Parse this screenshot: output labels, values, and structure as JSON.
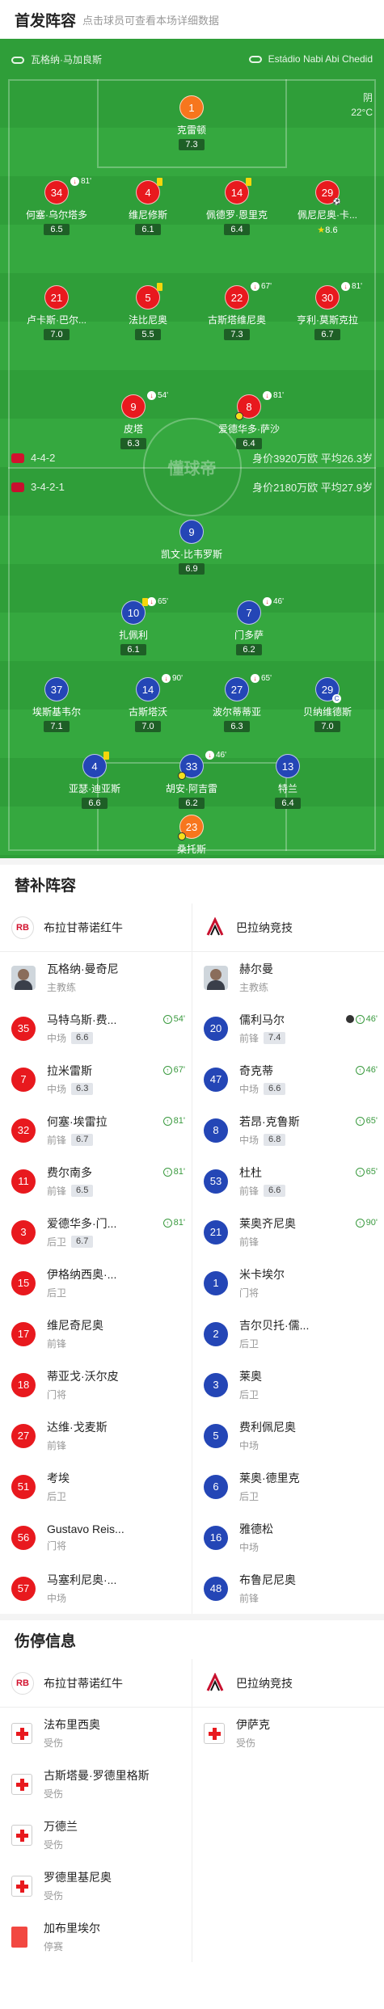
{
  "header": {
    "title": "首发阵容",
    "subtitle": "点击球员可查看本场详细数据"
  },
  "pitch": {
    "venue_left": "瓦格纳·马加良斯",
    "venue_right": "Estádio Nabi Abi Chedid",
    "weather": "阴",
    "temperature": "22°C",
    "center_logo": "懂球帝",
    "home_formation": "4-4-2",
    "home_value": "身价3920万欧 平均26.3岁",
    "away_formation": "3-4-2-1",
    "away_value": "身价2180万欧 平均27.9岁"
  },
  "home_players": [
    {
      "num": "1",
      "name": "克雷顿",
      "rating": "7.3",
      "color": "gk"
    },
    {
      "num": "34",
      "name": "何塞·乌尔塔多",
      "rating": "6.5",
      "sub": "81'"
    },
    {
      "num": "4",
      "name": "维尼修斯",
      "rating": "6.1",
      "yc": true
    },
    {
      "num": "14",
      "name": "佩德罗·恩里克",
      "rating": "6.4",
      "yc": true
    },
    {
      "num": "29",
      "name": "佩尼尼奥·卡...",
      "rating": "8.6",
      "star": true,
      "goal": true
    },
    {
      "num": "21",
      "name": "卢卡斯·巴尔...",
      "rating": "7.0"
    },
    {
      "num": "5",
      "name": "法比尼奥",
      "rating": "5.5",
      "yc": true
    },
    {
      "num": "22",
      "name": "古斯塔维尼奥",
      "rating": "7.3",
      "sub": "67'"
    },
    {
      "num": "30",
      "name": "亨利·莫斯克拉",
      "rating": "6.7",
      "sub": "81'"
    },
    {
      "num": "9",
      "name": "皮塔",
      "rating": "6.3",
      "sub": "54'"
    },
    {
      "num": "8",
      "name": "爱德华多·萨沙",
      "rating": "6.4",
      "sub": "81'",
      "gl": true
    }
  ],
  "away_players": [
    {
      "num": "9",
      "name": "凯文·比韦罗斯",
      "rating": "6.9"
    },
    {
      "num": "10",
      "name": "扎佩利",
      "rating": "6.1",
      "sub": "65'",
      "yc": true
    },
    {
      "num": "7",
      "name": "门多萨",
      "rating": "6.2",
      "sub": "46'"
    },
    {
      "num": "37",
      "name": "埃斯基韦尔",
      "rating": "7.1"
    },
    {
      "num": "14",
      "name": "古斯塔沃",
      "rating": "7.0",
      "sub": "90'"
    },
    {
      "num": "27",
      "name": "波尔蒂蒂亚",
      "rating": "6.3",
      "sub": "65'"
    },
    {
      "num": "29",
      "name": "贝纳维德斯",
      "rating": "7.0",
      "cap": true
    },
    {
      "num": "4",
      "name": "亚瑟·迪亚斯",
      "rating": "6.6",
      "yc": true
    },
    {
      "num": "33",
      "name": "胡安·阿吉雷",
      "rating": "6.2",
      "sub": "46'",
      "gl": true
    },
    {
      "num": "13",
      "name": "特兰",
      "rating": "6.4"
    },
    {
      "num": "23",
      "name": "桑托斯",
      "rating": "6.5",
      "color": "gk",
      "gl": true
    }
  ],
  "subs": {
    "title": "替补阵容",
    "home_team": "布拉甘蒂诺红牛",
    "away_team": "巴拉纳竞技",
    "home_coach": {
      "name": "瓦格纳·曼奇尼",
      "role": "主教练"
    },
    "away_coach": {
      "name": "赫尔曼",
      "role": "主教练"
    },
    "rows": [
      [
        {
          "num": "35",
          "name": "马特乌斯·费...",
          "pos": "中场",
          "rating": "6.6",
          "evt": "54'"
        },
        {
          "num": "20",
          "name": "儒利马尔",
          "pos": "前锋",
          "rating": "7.4",
          "evt": "46'",
          "ball": true
        }
      ],
      [
        {
          "num": "7",
          "name": "拉米雷斯",
          "pos": "中场",
          "rating": "6.3",
          "evt": "67'"
        },
        {
          "num": "47",
          "name": "奇克蒂",
          "pos": "中场",
          "rating": "6.6",
          "evt": "46'"
        }
      ],
      [
        {
          "num": "32",
          "name": "何塞·埃雷拉",
          "pos": "前锋",
          "rating": "6.7",
          "evt": "81'"
        },
        {
          "num": "8",
          "name": "若昂·克鲁斯",
          "pos": "中场",
          "rating": "6.8",
          "evt": "65'"
        }
      ],
      [
        {
          "num": "11",
          "name": "费尔南多",
          "pos": "前锋",
          "rating": "6.5",
          "evt": "81'"
        },
        {
          "num": "53",
          "name": "杜杜",
          "pos": "前锋",
          "rating": "6.6",
          "evt": "65'"
        }
      ],
      [
        {
          "num": "3",
          "name": "爱德华多·门...",
          "pos": "后卫",
          "rating": "6.7",
          "evt": "81'"
        },
        {
          "num": "21",
          "name": "莱奥齐尼奥",
          "pos": "前锋",
          "rating": "",
          "evt": "90'"
        }
      ],
      [
        {
          "num": "15",
          "name": "伊格纳西奥·...",
          "pos": "后卫"
        },
        {
          "num": "1",
          "name": "米卡埃尔",
          "pos": "门将"
        }
      ],
      [
        {
          "num": "17",
          "name": "维尼奇尼奥",
          "pos": "前锋"
        },
        {
          "num": "2",
          "name": "吉尔贝托·儒...",
          "pos": "后卫"
        }
      ],
      [
        {
          "num": "18",
          "name": "蒂亚戈·沃尔皮",
          "pos": "门将"
        },
        {
          "num": "3",
          "name": "莱奥",
          "pos": "后卫"
        }
      ],
      [
        {
          "num": "27",
          "name": "达维·戈麦斯",
          "pos": "前锋"
        },
        {
          "num": "5",
          "name": "费利佩尼奥",
          "pos": "中场"
        }
      ],
      [
        {
          "num": "51",
          "name": "考埃",
          "pos": "后卫"
        },
        {
          "num": "6",
          "name": "莱奥·德里克",
          "pos": "后卫"
        }
      ],
      [
        {
          "num": "56",
          "name": "Gustavo Reis...",
          "pos": "门将"
        },
        {
          "num": "16",
          "name": "雅德松",
          "pos": "中场"
        }
      ],
      [
        {
          "num": "57",
          "name": "马塞利尼奥·...",
          "pos": "中场"
        },
        {
          "num": "48",
          "name": "布鲁尼尼奥",
          "pos": "前锋"
        }
      ]
    ]
  },
  "injuries": {
    "title": "伤停信息",
    "home_team": "布拉甘蒂诺红牛",
    "away_team": "巴拉纳竞技",
    "home": [
      {
        "name": "法布里西奥",
        "status": "受伤",
        "type": "injury"
      },
      {
        "name": "古斯塔曼·罗德里格斯",
        "status": "受伤",
        "type": "injury"
      },
      {
        "name": "万德兰",
        "status": "受伤",
        "type": "injury"
      },
      {
        "name": "罗德里基尼奥",
        "status": "受伤",
        "type": "injury"
      },
      {
        "name": "加布里埃尔",
        "status": "停赛",
        "type": "red"
      }
    ],
    "away": [
      {
        "name": "伊萨克",
        "status": "受伤",
        "type": "injury"
      }
    ]
  },
  "colors": {
    "pitch": "#2f9e39",
    "home": "#e8191e",
    "away": "#2446b6",
    "gk": "#f7761d"
  }
}
